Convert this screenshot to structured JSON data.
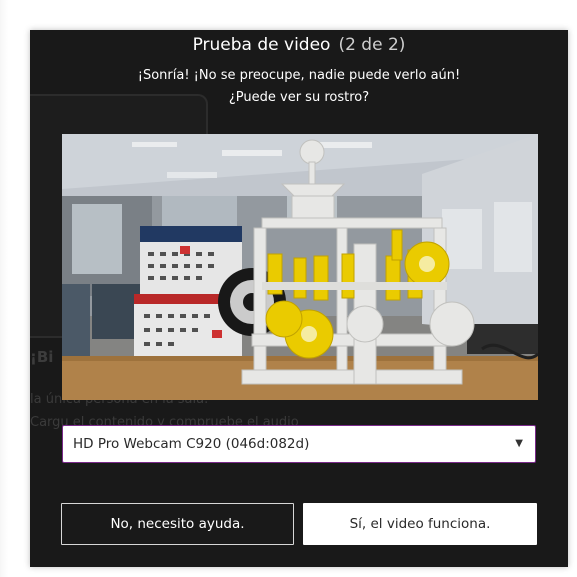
{
  "dialog": {
    "title": "Prueba de video",
    "step": "(2 de 2)",
    "line1": "¡Sonría! ¡No se preocupe, nadie puede verlo aún!",
    "line2": "¿Puede ver su rostro?"
  },
  "background_page": {
    "heading": "¡Bi",
    "line1": "la única persona en la sala.",
    "line2": "Cargu el contenido y compruebe el audio"
  },
  "camera_select": {
    "selected": "HD Pro Webcam C920 (046d:082d)"
  },
  "buttons": {
    "no_label": "No, necesito ayuda.",
    "yes_label": "Sí, el video funciona."
  },
  "colors": {
    "dialog_bg": "#191919",
    "select_border": "#7a2a8a",
    "gear_yellow": "#f4d400"
  },
  "icons": {
    "select_arrow": "caret-down-icon"
  }
}
